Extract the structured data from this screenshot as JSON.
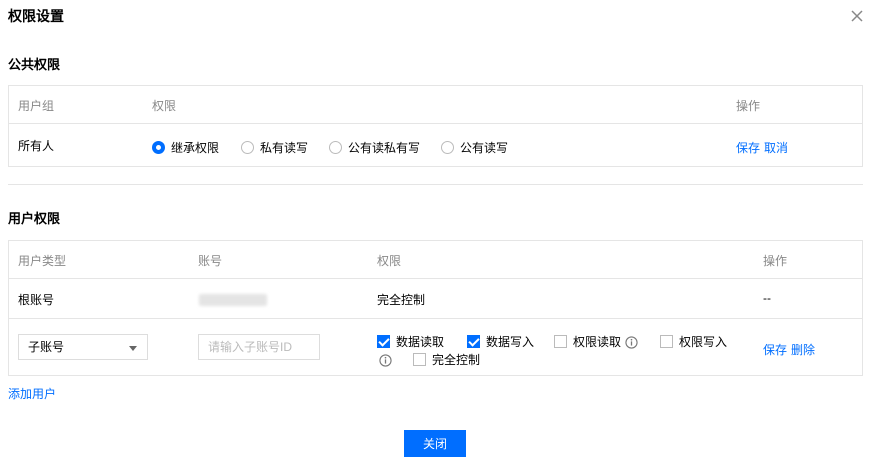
{
  "dialog": {
    "title": "权限设置",
    "close_icon": "close-icon"
  },
  "public": {
    "title": "公共权限",
    "headers": {
      "group": "用户组",
      "permission": "权限",
      "action": "操作"
    },
    "row": {
      "group": "所有人",
      "options": [
        {
          "label": "继承权限",
          "selected": true
        },
        {
          "label": "私有读写",
          "selected": false
        },
        {
          "label": "公有读私有写",
          "selected": false
        },
        {
          "label": "公有读写",
          "selected": false
        }
      ],
      "save": "保存",
      "cancel": "取消"
    }
  },
  "user": {
    "title": "用户权限",
    "headers": {
      "type": "用户类型",
      "account": "账号",
      "permission": "权限",
      "action": "操作"
    },
    "root_row": {
      "type": "根账号",
      "permission": "完全控制",
      "action": "--"
    },
    "sub_row": {
      "type_select": "子账号",
      "account_placeholder": "请输入子账号ID",
      "checks": [
        {
          "label": "数据读取",
          "checked": true
        },
        {
          "label": "数据写入",
          "checked": true
        },
        {
          "label": "权限读取",
          "checked": false
        },
        {
          "label": "权限写入",
          "checked": false
        },
        {
          "label": "完全控制",
          "checked": false
        }
      ],
      "save": "保存",
      "delete": "删除"
    }
  },
  "add_user": "添加用户",
  "close_button": "关闭",
  "colors": {
    "accent": "#006eff",
    "border": "#e5e5e5"
  }
}
